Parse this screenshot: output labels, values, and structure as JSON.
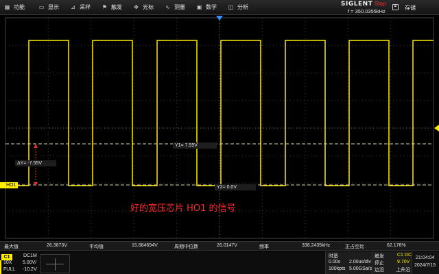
{
  "menu": [
    {
      "label": "功能",
      "icon": "function-icon"
    },
    {
      "label": "显示",
      "icon": "display-icon"
    },
    {
      "label": "采样",
      "icon": "acquire-icon"
    },
    {
      "label": "触发",
      "icon": "trigger-icon"
    },
    {
      "label": "光标",
      "icon": "cursor-icon"
    },
    {
      "label": "测量",
      "icon": "measure-icon"
    },
    {
      "label": "数学",
      "icon": "math-icon"
    },
    {
      "label": "分析",
      "icon": "analysis-icon"
    }
  ],
  "header": {
    "brand": "SIGLENT",
    "run_state": "Stop",
    "frequency": "f = 350.0355kHz",
    "save_label": "存储"
  },
  "cursors": {
    "y1_label": "Y1= 7.55V",
    "y2_label": "Y2= 0.0V",
    "delta_label": "ΔY= -7.55V"
  },
  "channel_marker": "HO1",
  "annotation": "好的宽压芯片 HO1 的信号",
  "measurements": [
    {
      "label": "最大值",
      "value": "26.3873V"
    },
    {
      "label": "平均值",
      "value": "15.884694V"
    },
    {
      "label": "周期中位数",
      "value": "26.0147V"
    },
    {
      "label": "频率",
      "value": "338.2435kHz"
    },
    {
      "label": "正占空比",
      "value": "62.176%"
    }
  ],
  "channel": {
    "name": "C1",
    "coupling": "DC1M",
    "probe": "10X",
    "scale": "5.00V/",
    "bandwidth": "FULL",
    "offset": "-10.2V"
  },
  "timebase": {
    "title": "时基",
    "delay": "0.00s",
    "scale": "2.00us/div",
    "memory": "100kpts",
    "sample_rate": "5.00GSa/s"
  },
  "trigger": {
    "title": "触发",
    "source": "C1 DC",
    "mode": "停止",
    "level": "9.70V",
    "type": "边沿",
    "slope": "上升沿"
  },
  "clock": {
    "time": "21:04:04",
    "date": "2024/7/15"
  },
  "colors": {
    "trace": "#ffec00",
    "annotation": "#ff2a2a",
    "stop": "#ff3030",
    "cursor": "#d8d8a8"
  }
}
